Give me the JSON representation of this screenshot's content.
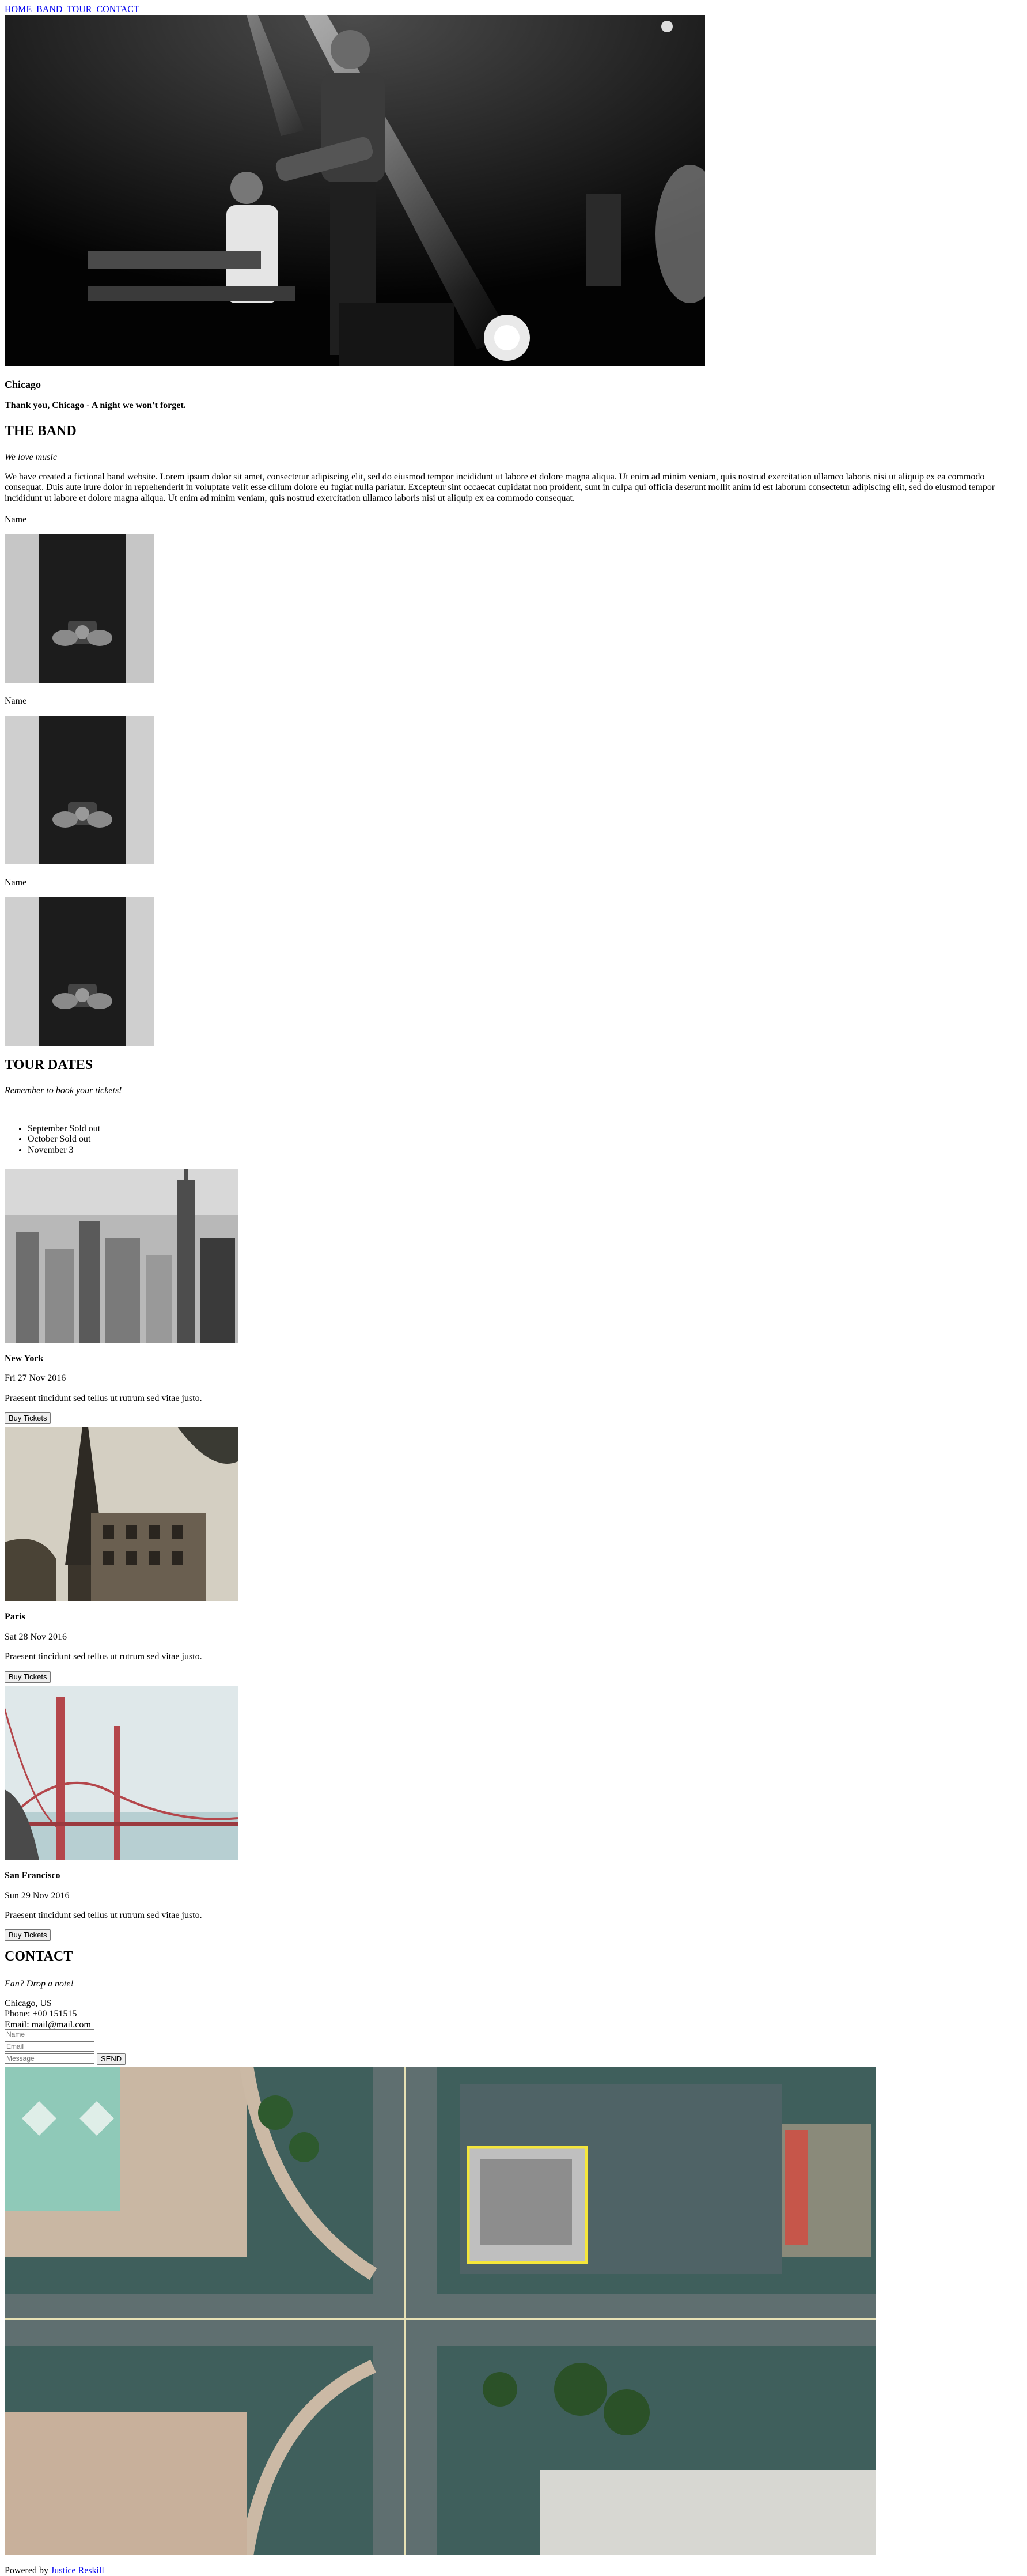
{
  "nav": {
    "items": [
      {
        "label": "HOME"
      },
      {
        "label": "BAND"
      },
      {
        "label": "TOUR"
      },
      {
        "label": "CONTACT"
      }
    ]
  },
  "hero": {
    "title": "Chicago",
    "subtitle": "Thank you, Chicago - A night we won't forget."
  },
  "band": {
    "heading": "THE BAND",
    "tagline": "We love music",
    "body": "We have created a fictional band website. Lorem ipsum dolor sit amet, consectetur adipiscing elit, sed do eiusmod tempor incididunt ut labore et dolore magna aliqua. Ut enim ad minim veniam, quis nostrud exercitation ullamco laboris nisi ut aliquip ex ea commodo consequat. Duis aute irure dolor in reprehenderit in voluptate velit esse cillum dolore eu fugiat nulla pariatur. Excepteur sint occaecat cupidatat non proident, sunt in culpa qui officia deserunt mollit anim id est laborum consectetur adipiscing elit, sed do eiusmod tempor incididunt ut labore et dolore magna aliqua. Ut enim ad minim veniam, quis nostrud exercitation ullamco laboris nisi ut aliquip ex ea commodo consequat.",
    "members": [
      {
        "name": "Name"
      },
      {
        "name": "Name"
      },
      {
        "name": "Name"
      }
    ]
  },
  "tour": {
    "heading": "TOUR DATES",
    "tagline": "Remember to book your tickets!",
    "months": [
      {
        "label": "September Sold out"
      },
      {
        "label": "October Sold out"
      },
      {
        "label": "November 3"
      }
    ],
    "shows": [
      {
        "city": "New York",
        "date": "Fri 27 Nov 2016",
        "desc": "Praesent tincidunt sed tellus ut rutrum sed vitae justo.",
        "button": "Buy Tickets"
      },
      {
        "city": "Paris",
        "date": "Sat 28 Nov 2016",
        "desc": "Praesent tincidunt sed tellus ut rutrum sed vitae justo.",
        "button": "Buy Tickets"
      },
      {
        "city": "San Francisco",
        "date": "Sun 29 Nov 2016",
        "desc": "Praesent tincidunt sed tellus ut rutrum sed vitae justo.",
        "button": "Buy Tickets"
      }
    ]
  },
  "contact": {
    "heading": "CONTACT",
    "tagline": "Fan? Drop a note!",
    "location": "Chicago, US",
    "phone": "Phone: +00 151515",
    "email": "Email: mail@mail.com",
    "name_placeholder": "Name",
    "email_placeholder": "Email",
    "message_placeholder": "Message",
    "send_label": "SEND"
  },
  "footer": {
    "prefix": "Powered by ",
    "link": "Justice Reskill"
  },
  "colors": {
    "link": "#0000ee",
    "map_highlight": "#f5e63a"
  }
}
